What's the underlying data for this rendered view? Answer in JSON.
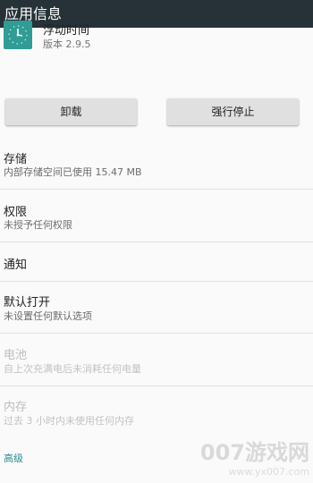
{
  "appbar": {
    "title": "应用信息"
  },
  "app": {
    "name": "浮动时间",
    "version": "版本 2.9.5",
    "icon": "clock-icon",
    "icon_color": "#2f9c95"
  },
  "buttons": {
    "uninstall": "卸载",
    "force_stop": "强行停止"
  },
  "sections": {
    "storage": {
      "title": "存储",
      "subtitle": "内部存储空间已使用 15.47 MB"
    },
    "permissions": {
      "title": "权限",
      "subtitle": "未授予任何权限"
    },
    "notifications": {
      "title": "通知"
    },
    "open_by_default": {
      "title": "默认打开",
      "subtitle": "未设置任何默认选项"
    },
    "battery": {
      "title": "电池",
      "subtitle": "自上次充满电后未消耗任何电量"
    },
    "memory": {
      "title": "内存",
      "subtitle": "过去 3 小时内未使用任何内存"
    }
  },
  "advanced": "高级",
  "watermark": {
    "text": "007游戏网",
    "url": "www.yx007.com"
  },
  "colors": {
    "appbar": "#263238",
    "accent": "#2e8b8b"
  }
}
